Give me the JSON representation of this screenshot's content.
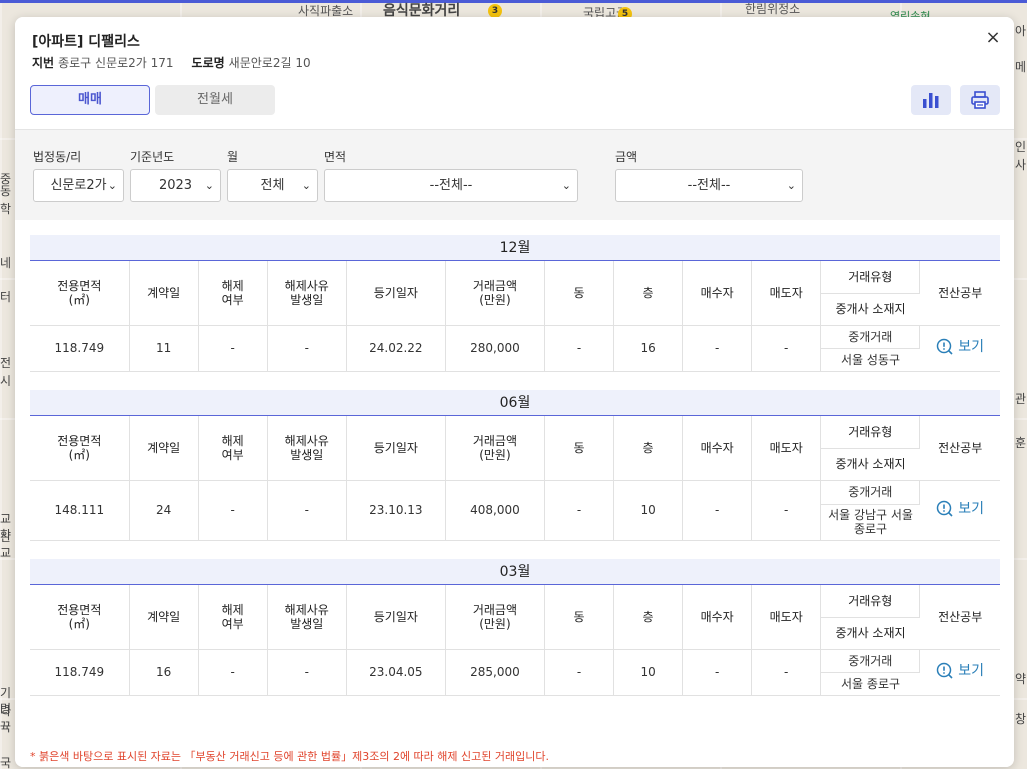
{
  "map": {
    "labels": [
      "사직파출소",
      "음식문화거리",
      "국립고궁",
      "한림위정소",
      "열린송현"
    ],
    "badges": [
      "3",
      "5"
    ],
    "left_edge": [
      "중",
      "동학",
      "네",
      "터",
      "전시",
      "사",
      "교산",
      "학교",
      "기다",
      "명뀩",
      "국"
    ],
    "right_edge": [
      "아",
      "메",
      "인사",
      "관",
      "훈",
      "약",
      "창"
    ]
  },
  "modal": {
    "title": "[아파트] 디팰리스",
    "jibun_label": "지번",
    "jibun_value": "종로구 신문로2가 171",
    "road_label": "도로명",
    "road_value": "새문안로2길 10",
    "close_icon": "×",
    "tabs": {
      "sale": "매매",
      "rent": "전월세"
    },
    "icons": {
      "chart": "bar-chart-icon",
      "print": "printer-icon"
    },
    "accent": "#5a66d8"
  },
  "filters": {
    "dong": {
      "label": "법정동/리",
      "value": "신문로2가"
    },
    "year": {
      "label": "기준년도",
      "value": "2023"
    },
    "month": {
      "label": "월",
      "value": "전체"
    },
    "area": {
      "label": "면적",
      "value": "--전체--"
    },
    "price": {
      "label": "금액",
      "value": "--전체--"
    }
  },
  "table_headers": {
    "area": "전용면적\n(㎡)",
    "contract_day": "계약일",
    "cancel": "해제\n여부",
    "cancel_date": "해제사유\n발생일",
    "reg_date": "등기일자",
    "price": "거래금액\n(만원)",
    "dong": "동",
    "floor": "층",
    "buyer": "매수자",
    "seller": "매도자",
    "deal_type": "거래유형",
    "broker": "중개사 소재지",
    "registry": "전산공부"
  },
  "sections": [
    {
      "month": "12월",
      "row": {
        "area": "118.749",
        "day": "11",
        "cancel": "-",
        "cancel_date": "-",
        "reg_date": "24.02.22",
        "price": "280,000",
        "dong": "-",
        "floor": "16",
        "buyer": "-",
        "seller": "-",
        "deal_type": "중개거래",
        "broker": "서울 성동구",
        "view": "보기"
      }
    },
    {
      "month": "06월",
      "row": {
        "area": "148.111",
        "day": "24",
        "cancel": "-",
        "cancel_date": "-",
        "reg_date": "23.10.13",
        "price": "408,000",
        "dong": "-",
        "floor": "10",
        "buyer": "-",
        "seller": "-",
        "deal_type": "중개거래",
        "broker": "서울 강남구 서울\n종로구",
        "view": "보기"
      }
    },
    {
      "month": "03월",
      "row": {
        "area": "118.749",
        "day": "16",
        "cancel": "-",
        "cancel_date": "-",
        "reg_date": "23.04.05",
        "price": "285,000",
        "dong": "-",
        "floor": "10",
        "buyer": "-",
        "seller": "-",
        "deal_type": "중개거래",
        "broker": "서울 종로구",
        "view": "보기"
      }
    }
  ],
  "note": "* 붉은색 바탕으로 표시된 자료는 「부동산 거래신고 등에 관한 법률」제3조의 2에 따라 해제 신고된 거래입니다."
}
